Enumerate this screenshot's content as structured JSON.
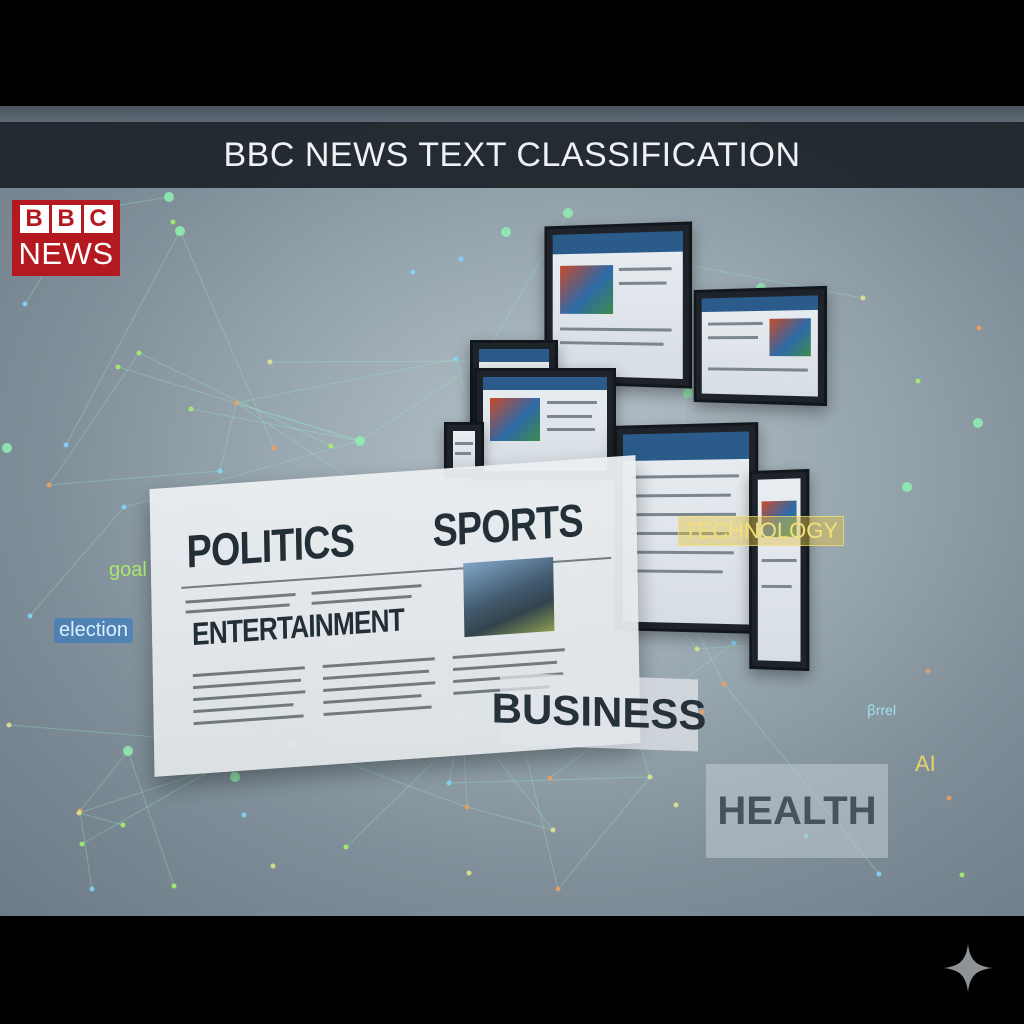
{
  "banner": {
    "title": "BBC NEWS TEXT CLASSIFICATION"
  },
  "logo": {
    "letters": [
      "B",
      "B",
      "C"
    ],
    "word": "NEWS",
    "color": "#b3191f"
  },
  "newspaper": {
    "headlines": {
      "politics": "POLITICS",
      "sports": "SPORTS",
      "entertainment": "ENTERTAINMENT"
    }
  },
  "categories": {
    "technology": "TECHNOLOGY",
    "business": "BUSINESS",
    "health": "HEALTH"
  },
  "keywords": {
    "goal": "goal",
    "election": "election",
    "ai": "AI",
    "snippet": "ꞵrrel"
  },
  "icons": {
    "corner": "sparkle-icon"
  }
}
